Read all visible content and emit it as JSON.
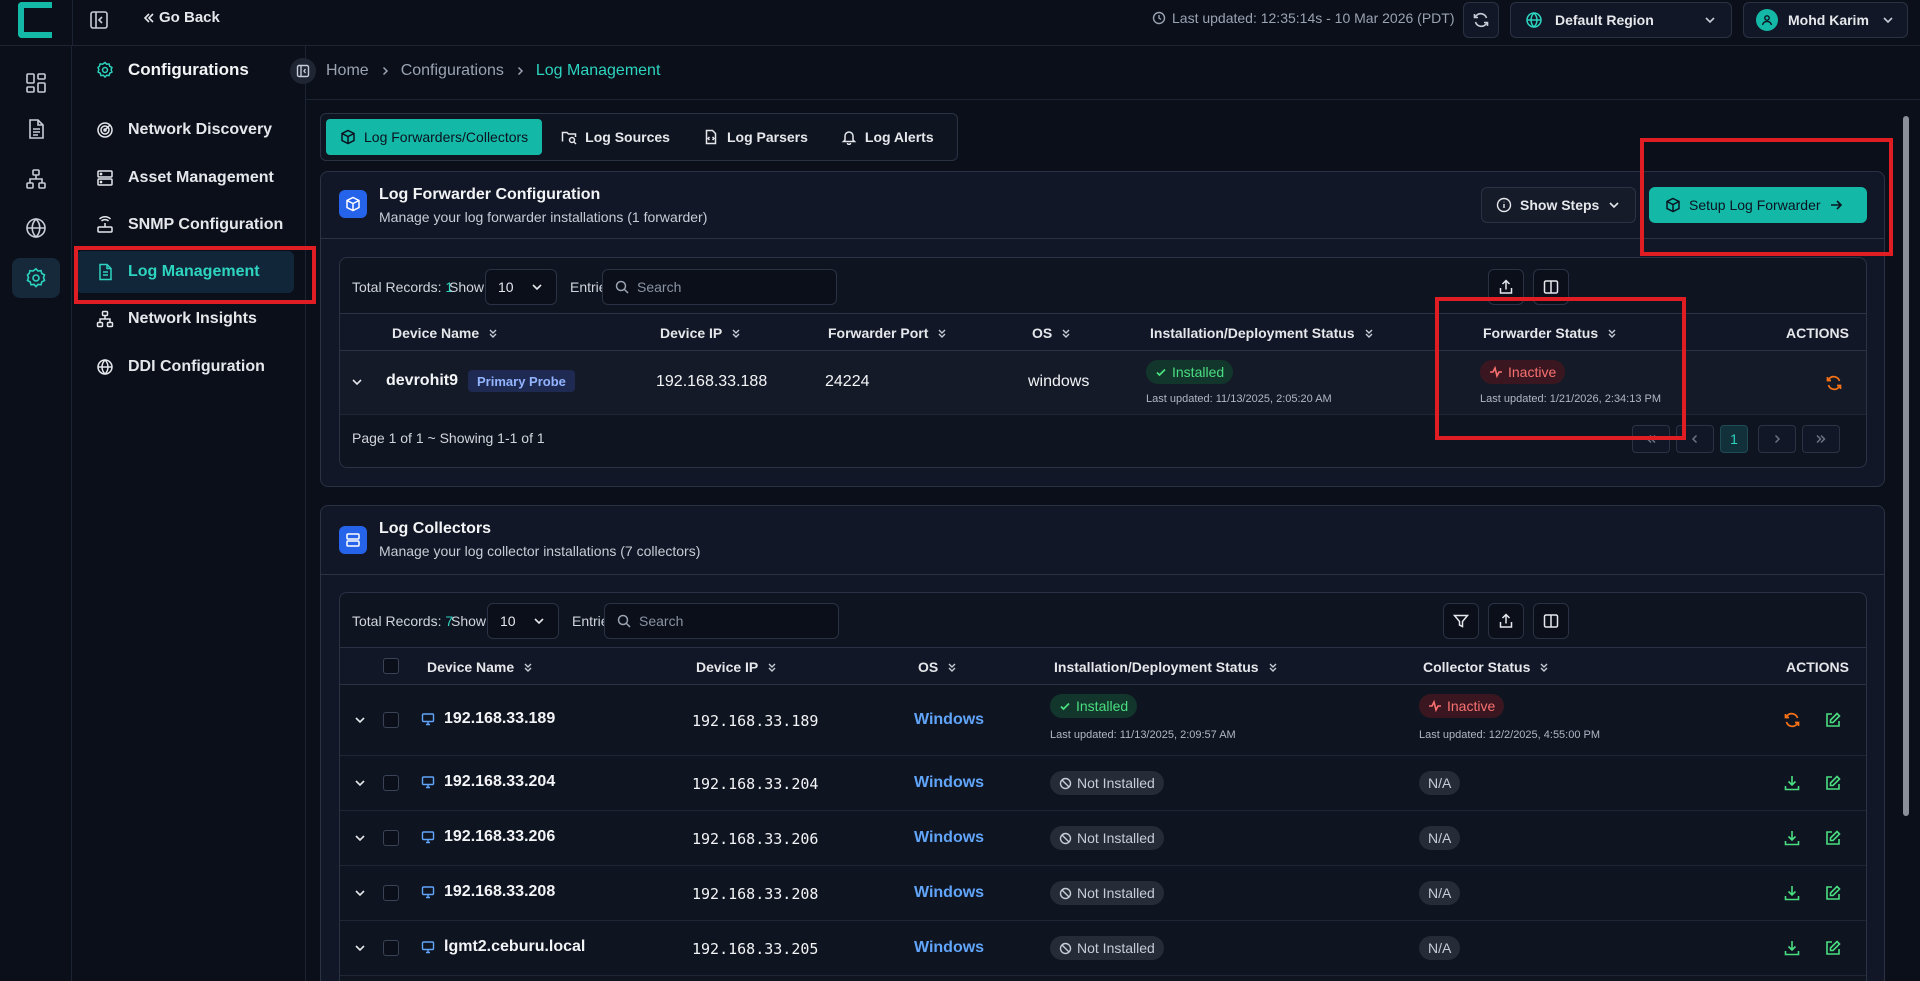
{
  "topbar": {
    "go_back": "Go Back",
    "last_updated": "Last updated: 12:35:14s - 10 Mar 2026 (PDT)",
    "region": "Default Region",
    "user": "Mohd Karim"
  },
  "sidebar": {
    "title": "Configurations",
    "items": [
      {
        "label": "Network Discovery"
      },
      {
        "label": "Asset Management"
      },
      {
        "label": "SNMP Configuration"
      },
      {
        "label": "Log Management"
      },
      {
        "label": "Network Insights"
      },
      {
        "label": "DDI Configuration"
      }
    ]
  },
  "breadcrumb": [
    "Home",
    "Configurations",
    "Log Management"
  ],
  "tabs": [
    "Log Forwarders/Collectors",
    "Log Sources",
    "Log Parsers",
    "Log Alerts"
  ],
  "forwarder": {
    "title": "Log Forwarder Configuration",
    "subtitle": "Manage your log forwarder installations (1 forwarder)",
    "show_steps": "Show Steps",
    "setup_btn": "Setup Log Forwarder",
    "total_label": "Total Records:",
    "total": "1",
    "show_label": "Show",
    "page_size": "10",
    "entries_label": "Entries",
    "search_placeholder": "Search",
    "columns": [
      "Device Name",
      "Device IP",
      "Forwarder Port",
      "OS",
      "Installation/Deployment Status",
      "Forwarder Status",
      "ACTIONS"
    ],
    "rows": [
      {
        "device": "devrohit9",
        "tag": "Primary Probe",
        "ip": "192.168.33.188",
        "port": "24224",
        "os": "windows",
        "install_status": "Installed",
        "install_updated": "Last updated: 11/13/2025, 2:05:20 AM",
        "fwd_status": "Inactive",
        "fwd_updated": "Last updated: 1/21/2026, 2:34:13 PM"
      }
    ],
    "page_info": "Page 1 of 1 ~ Showing 1-1 of 1",
    "current_page": "1"
  },
  "collectors": {
    "title": "Log Collectors",
    "subtitle": "Manage your log collector installations (7 collectors)",
    "total_label": "Total Records:",
    "total": "7",
    "show_label": "Show",
    "page_size": "10",
    "entries_label": "Entries",
    "search_placeholder": "Search",
    "columns": [
      "Device Name",
      "Device IP",
      "OS",
      "Installation/Deployment Status",
      "Collector Status",
      "ACTIONS"
    ],
    "rows": [
      {
        "device": "192.168.33.189",
        "ip": "192.168.33.189",
        "os": "Windows",
        "install_status": "Installed",
        "install_updated": "Last updated: 11/13/2025, 2:09:57 AM",
        "col_status": "Inactive",
        "col_updated": "Last updated: 12/2/2025, 4:55:00 PM"
      },
      {
        "device": "192.168.33.204",
        "ip": "192.168.33.204",
        "os": "Windows",
        "install_status": "Not Installed",
        "col_status": "N/A"
      },
      {
        "device": "192.168.33.206",
        "ip": "192.168.33.206",
        "os": "Windows",
        "install_status": "Not Installed",
        "col_status": "N/A"
      },
      {
        "device": "192.168.33.208",
        "ip": "192.168.33.208",
        "os": "Windows",
        "install_status": "Not Installed",
        "col_status": "N/A"
      },
      {
        "device": "lgmt2.ceburu.local",
        "ip": "192.168.33.205",
        "os": "Windows",
        "install_status": "Not Installed",
        "col_status": "N/A"
      }
    ]
  },
  "colors": {
    "accent": "#14b8a6",
    "annotation": "#e11d24",
    "link": "#60a5fa"
  }
}
